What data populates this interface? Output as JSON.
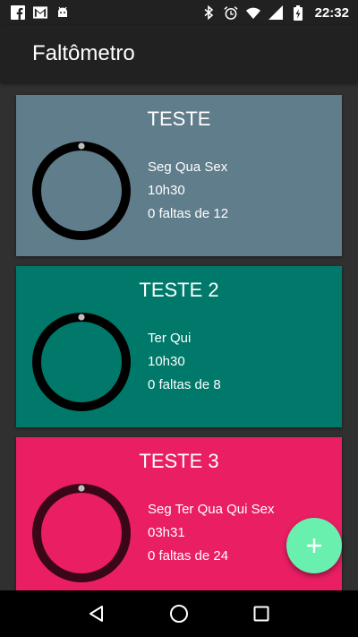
{
  "status_bar": {
    "time": "22:32",
    "icons_left": [
      "facebook-icon",
      "gmail-icon",
      "android-icon"
    ],
    "icons_right": [
      "bluetooth-icon",
      "alarm-icon",
      "wifi-icon",
      "signal-icon",
      "battery-charging-icon"
    ]
  },
  "app_bar": {
    "title": "Faltômetro"
  },
  "cards": [
    {
      "title": "TESTE",
      "days": "Seg Qua Sex",
      "time": "10h30",
      "absences": "0 faltas de 12",
      "color": "#607d8b",
      "absence_fraction": 0
    },
    {
      "title": "TESTE 2",
      "days": "Ter Qui",
      "time": "10h30",
      "absences": "0 faltas de 8",
      "color": "#00796b",
      "absence_fraction": 0
    },
    {
      "title": "TESTE 3",
      "days": "Seg Ter Qua Qui Sex",
      "time": "03h31",
      "absences": "0 faltas de 24",
      "color": "#e91e63",
      "absence_fraction": 0
    }
  ],
  "fab": {
    "icon": "plus-icon",
    "color": "#69f0ae"
  },
  "nav_bar": {
    "buttons": [
      "back-icon",
      "home-icon",
      "recents-icon"
    ]
  }
}
